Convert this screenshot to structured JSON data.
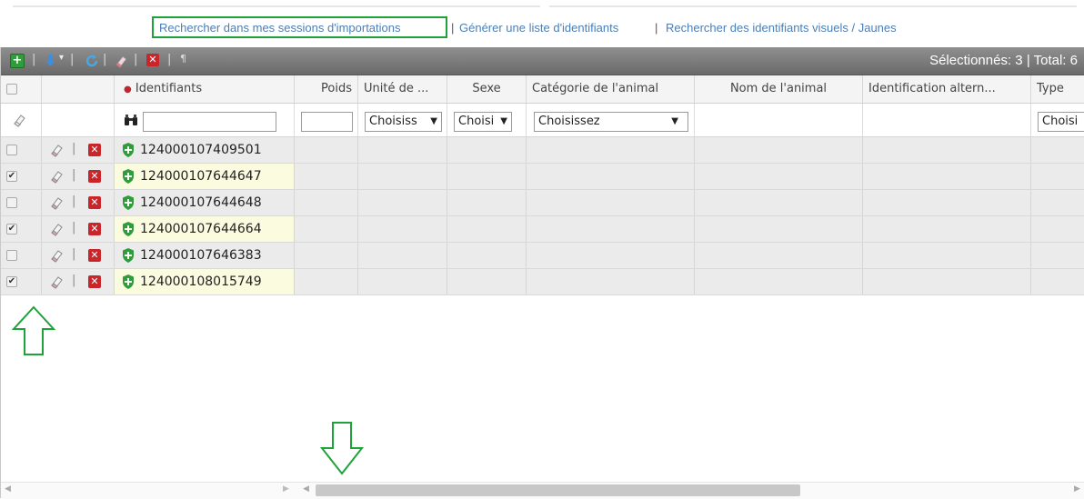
{
  "links": {
    "import_sessions": "Rechercher dans mes sessions d'importations",
    "separator": "|",
    "generate_list": "Générer une liste d'identifiants",
    "visual_search": "Rechercher des identifiants visuels / Jaunes"
  },
  "toolbar": {
    "separator": "|",
    "paragraph_glyph": "¶",
    "selected_label": "Sélectionnés: 3",
    "total_label": "Total: 6"
  },
  "columns": {
    "identifiants": "Identifiants",
    "poids": "Poids",
    "unite": "Unité de ...",
    "sexe": "Sexe",
    "categorie": "Catégorie de l'animal",
    "nom": "Nom de l'animal",
    "identification": "Identification altern...",
    "type": "Type"
  },
  "filters": {
    "unite_value": "Choisiss",
    "sexe_value": "Choisi",
    "categorie_value": "Choisissez",
    "type_value": "Choisi"
  },
  "rows": [
    {
      "id": "124000107409501",
      "checked": false
    },
    {
      "id": "124000107644647",
      "checked": true
    },
    {
      "id": "124000107644648",
      "checked": false
    },
    {
      "id": "124000107644664",
      "checked": true
    },
    {
      "id": "124000107646383",
      "checked": false
    },
    {
      "id": "124000108015749",
      "checked": true
    }
  ],
  "colors": {
    "highlight_green": "#1fa23a",
    "link_blue": "#4a7fb8",
    "selected_row_id_bg": "#fbfbe0"
  },
  "icons": {
    "add": "add-icon",
    "download": "download-icon",
    "refresh": "refresh-icon",
    "eraser": "eraser-icon",
    "delete": "delete-icon",
    "binoculars": "binoculars-icon",
    "shield": "shield-plus-icon"
  }
}
